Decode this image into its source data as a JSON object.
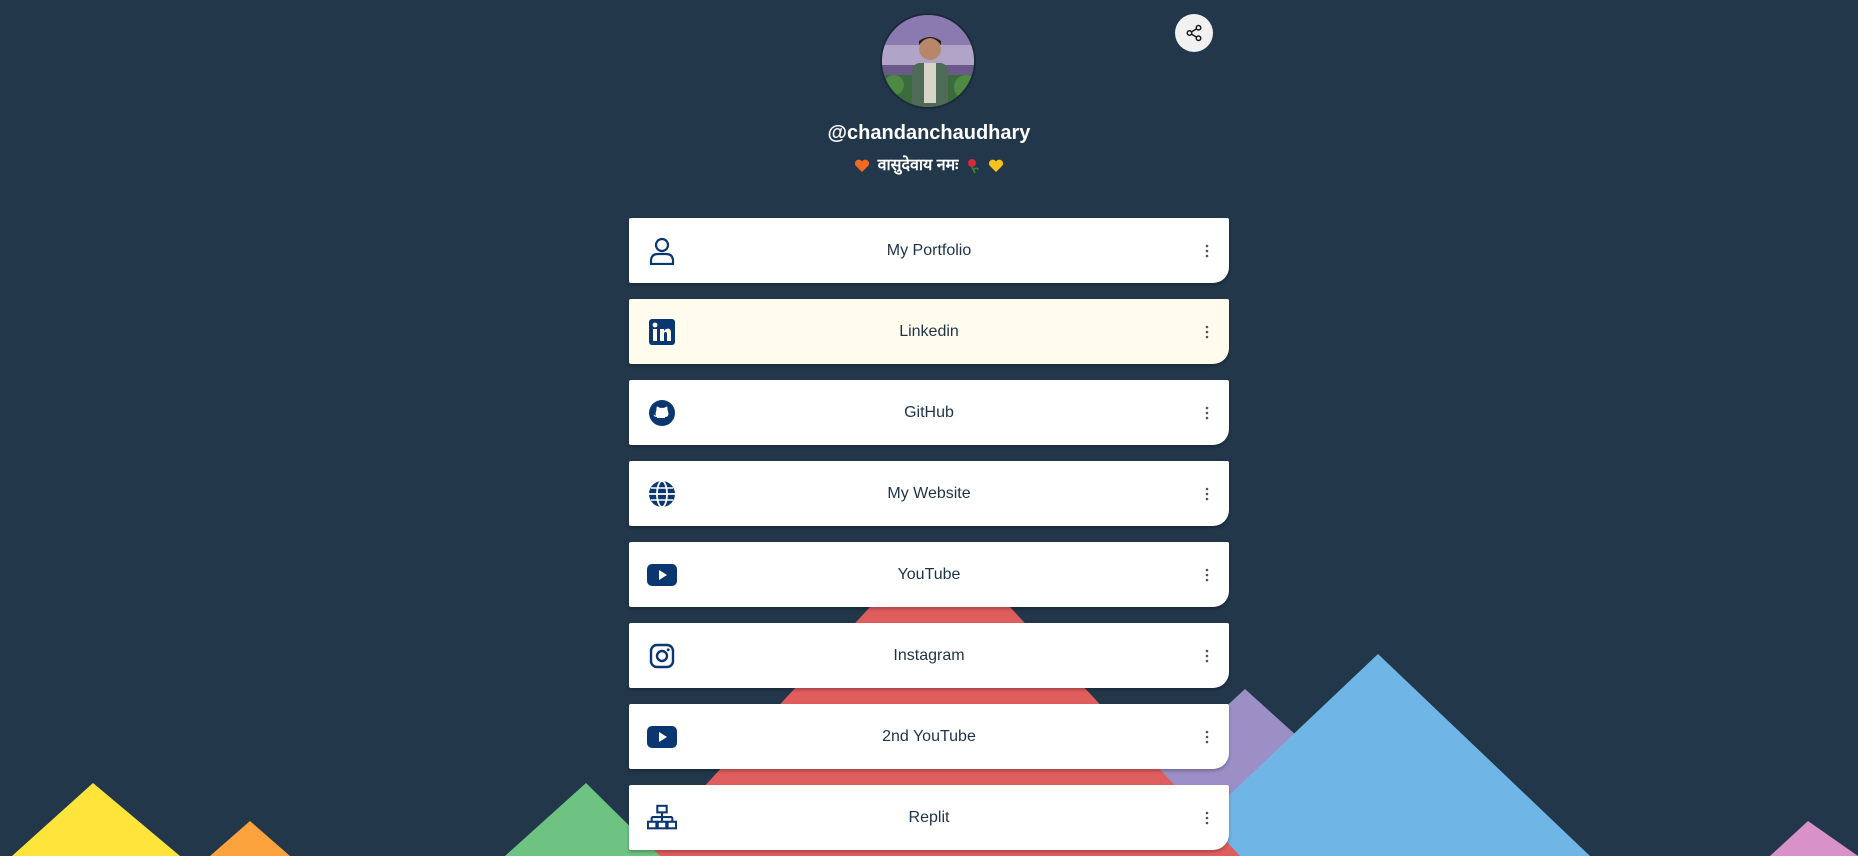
{
  "profile": {
    "username": "@chandanchaudhary",
    "bio_text": "वासुदेवाय नमः",
    "bio_emojis": [
      "orange-heart",
      "rose",
      "yellow-heart"
    ]
  },
  "header": {
    "share_icon": "share-icon"
  },
  "links": [
    {
      "label": "My Portfolio",
      "icon": "person-icon"
    },
    {
      "label": "Linkedin",
      "icon": "linkedin-icon"
    },
    {
      "label": "GitHub",
      "icon": "github-icon"
    },
    {
      "label": "My Website",
      "icon": "globe-icon"
    },
    {
      "label": "YouTube",
      "icon": "youtube-icon"
    },
    {
      "label": "Instagram",
      "icon": "instagram-icon"
    },
    {
      "label": "2nd YouTube",
      "icon": "youtube-icon"
    },
    {
      "label": "Replit",
      "icon": "network-icon"
    }
  ],
  "colors": {
    "background": "#22374a",
    "card": "#ffffff",
    "card_highlight": "#fffcee",
    "icon": "#0b3771",
    "mountain_red": "#e05d5e",
    "mountain_blue": "#6fb5e5",
    "mountain_purple": "#9b8fc6",
    "mountain_green": "#6ec383",
    "mountain_yellow": "#ffe43c",
    "mountain_orange": "#fda33e",
    "mountain_pink": "#d991c9"
  }
}
